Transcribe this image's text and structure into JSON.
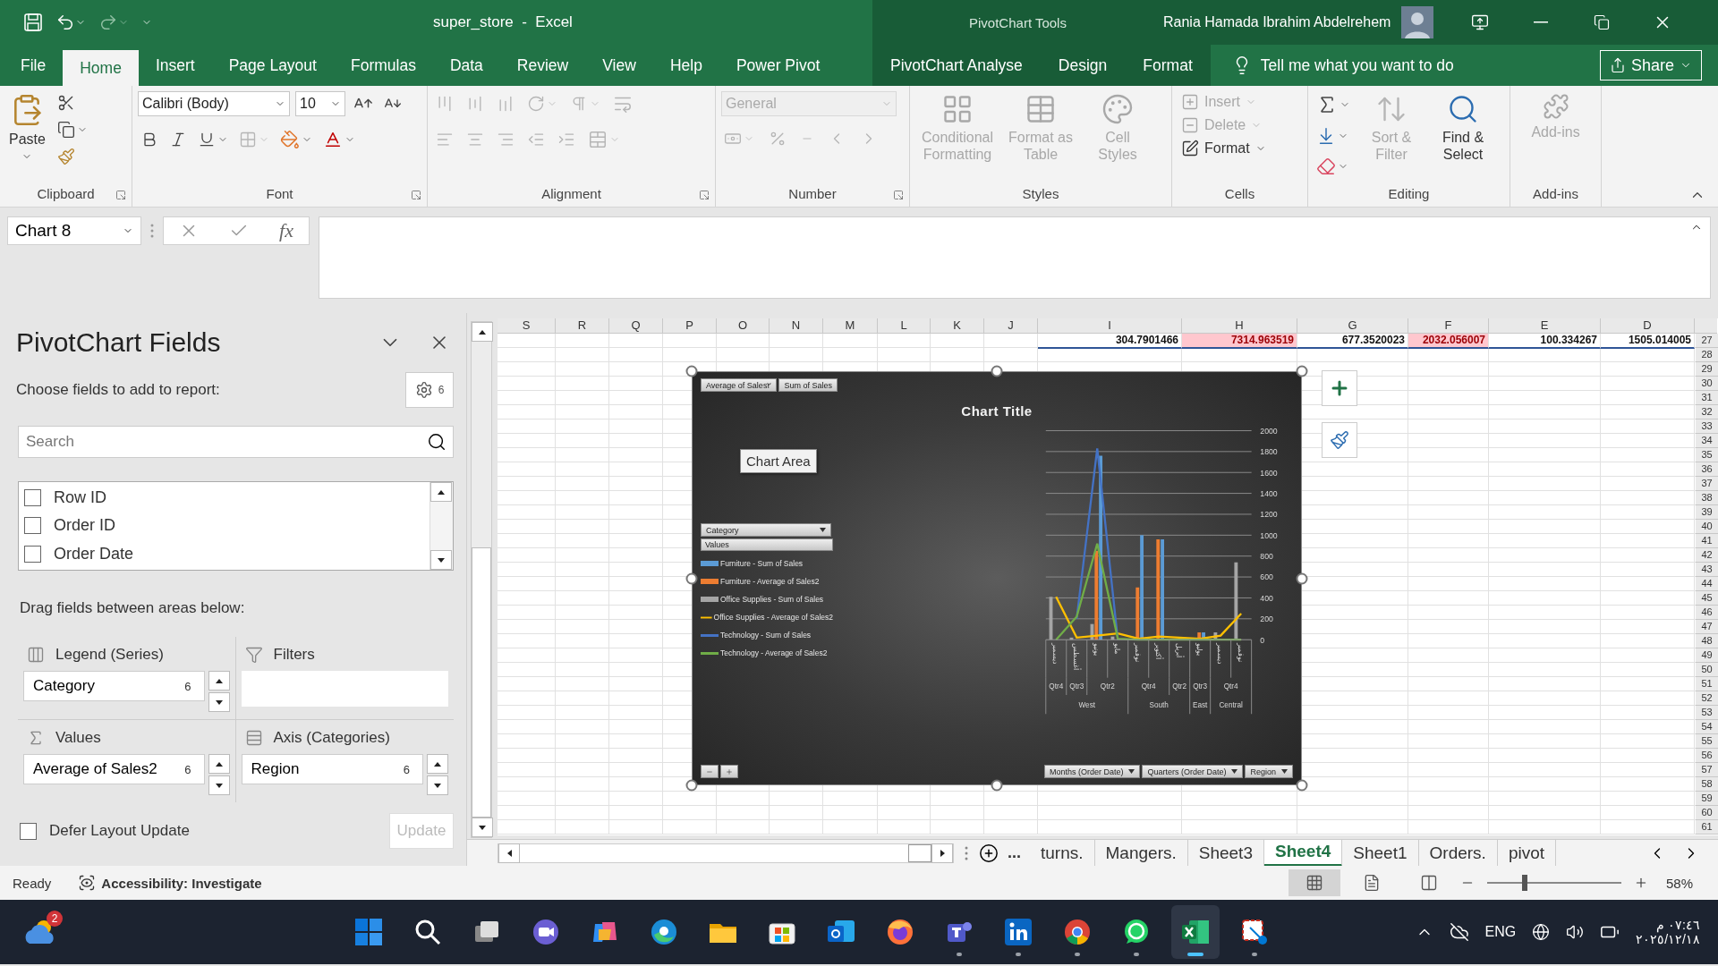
{
  "title_bar": {
    "document_title": "super_store  -  Excel",
    "contextual_tools": "PivotChart Tools",
    "user_name": "Rania Hamada Ibrahim Abdelrehem"
  },
  "ribbon_tabs": [
    {
      "label": "File",
      "selected": false,
      "contextual": false
    },
    {
      "label": "Home",
      "selected": true,
      "contextual": false
    },
    {
      "label": "Insert",
      "selected": false,
      "contextual": false
    },
    {
      "label": "Page Layout",
      "selected": false,
      "contextual": false
    },
    {
      "label": "Formulas",
      "selected": false,
      "contextual": false
    },
    {
      "label": "Data",
      "selected": false,
      "contextual": false
    },
    {
      "label": "Review",
      "selected": false,
      "contextual": false
    },
    {
      "label": "View",
      "selected": false,
      "contextual": false
    },
    {
      "label": "Help",
      "selected": false,
      "contextual": false
    },
    {
      "label": "Power Pivot",
      "selected": false,
      "contextual": false
    },
    {
      "label": "PivotChart Analyse",
      "selected": false,
      "contextual": true
    },
    {
      "label": "Design",
      "selected": false,
      "contextual": true
    },
    {
      "label": "Format",
      "selected": false,
      "contextual": true
    }
  ],
  "tell_me": "Tell me what you want to do",
  "share_button": "Share",
  "ribbon_groups": [
    {
      "kind": "clipboard",
      "label": "Clipboard",
      "paste": "Paste"
    },
    {
      "kind": "font",
      "label": "Font",
      "font_name": "Calibri (Body)",
      "font_size": "10"
    },
    {
      "kind": "alignment",
      "label": "Alignment",
      "disabled": true
    },
    {
      "kind": "number",
      "label": "Number",
      "format": "General",
      "disabled": true
    },
    {
      "kind": "styles",
      "label": "Styles",
      "buttons": [
        {
          "label": "Conditional Formatting",
          "disabled": true
        },
        {
          "label": "Format as Table",
          "disabled": true
        },
        {
          "label": "Cell Styles",
          "disabled": true
        }
      ]
    },
    {
      "kind": "cells",
      "label": "Cells",
      "buttons": [
        {
          "label": "Insert",
          "disabled": true
        },
        {
          "label": "Delete",
          "disabled": true
        },
        {
          "label": "Format",
          "disabled": false
        }
      ]
    },
    {
      "kind": "editing",
      "label": "Editing",
      "buttons": [
        {
          "label": "Sort & Filter",
          "disabled": true
        },
        {
          "label": "Find & Select",
          "disabled": false
        }
      ]
    },
    {
      "kind": "addins",
      "label": "Add-ins",
      "buttons": [
        {
          "label": "Add-ins",
          "disabled": true
        }
      ]
    }
  ],
  "formula_bar": {
    "name_box": "Chart 8",
    "function_label": "fx"
  },
  "pivot_pane": {
    "title": "PivotChart Fields",
    "instruction": "Choose fields to add to report:",
    "tools_badge": "6",
    "search": {
      "placeholder": "Search"
    },
    "fields": [
      {
        "label": "Row ID",
        "checked": false
      },
      {
        "label": "Order ID",
        "checked": false
      },
      {
        "label": "Order Date",
        "checked": false
      }
    ],
    "areas_instruction": "Drag fields between areas below:",
    "areas": [
      {
        "kind": "legend",
        "label": "Legend (Series)",
        "items": [
          {
            "label": "Category",
            "count": "6"
          }
        ]
      },
      {
        "kind": "filters",
        "label": "Filters"
      },
      {
        "kind": "values",
        "label": "Values",
        "items": [
          {
            "label": "Average of Sales2",
            "count": "6"
          }
        ]
      },
      {
        "kind": "axis",
        "label": "Axis (Categories)",
        "items": [
          {
            "label": "Region",
            "count": "6"
          }
        ]
      }
    ],
    "defer_update": {
      "label": "Defer Layout Update",
      "checked": false
    },
    "update_button": {
      "label": "Update",
      "disabled": true
    }
  },
  "sheet": {
    "columns": [
      "S",
      "R",
      "Q",
      "P",
      "O",
      "N",
      "M",
      "L",
      "K",
      "J",
      "I",
      "H",
      "G",
      "F",
      "E",
      "D"
    ],
    "row_numbers": [
      "27",
      "28",
      "29",
      "30",
      "31",
      "32",
      "33",
      "34",
      "35",
      "36",
      "37",
      "38",
      "39",
      "40",
      "41",
      "42",
      "43",
      "44",
      "45",
      "46",
      "47",
      "48",
      "49",
      "50",
      "51",
      "52",
      "53",
      "54",
      "55",
      "56",
      "57",
      "58",
      "59",
      "60",
      "61"
    ],
    "first_row_cells": [
      {
        "value": "304.7901466",
        "highlighted": false
      },
      {
        "value": "7314.963519",
        "highlighted": true
      },
      {
        "value": "677.3520023",
        "highlighted": false
      },
      {
        "value": "2032.056007",
        "highlighted": true
      },
      {
        "value": "100.334267",
        "highlighted": false
      },
      {
        "value": "1505.014005",
        "highlighted": false
      }
    ]
  },
  "chart": {
    "field_buttons_top": [
      "Average of Sales٢",
      "Sum of Sales"
    ],
    "tooltip": "Chart Area",
    "legend_field": "Category",
    "legend_header": "Values",
    "axis_field_buttons": [
      "Months (Order Date)",
      "Quarters (Order Date)",
      "Region"
    ],
    "chart_data": {
      "type": "bar",
      "title": "Chart Title",
      "categories": [
        "ديسمبر",
        "أغسطس",
        "يونيو",
        "مايو",
        "نوفمبر",
        "أكتوبر",
        "أبريل",
        "يوليو",
        "ديسمبر",
        "نوفمبر"
      ],
      "stacked": false,
      "grid": true,
      "series": [
        {
          "name": "Furniture - Sum of Sales",
          "type": "bar",
          "color": "#5b9bd5",
          "values": [
            null,
            null,
            1760,
            null,
            1000,
            960,
            null,
            70,
            null,
            null
          ]
        },
        {
          "name": "Furniture - Average of Sales2",
          "type": "bar",
          "color": "#ed7d31",
          "values": [
            null,
            null,
            850,
            null,
            500,
            960,
            null,
            70,
            null,
            null
          ]
        },
        {
          "name": "Office Supplies - Sum of Sales",
          "type": "bar",
          "color": "#a5a5a5",
          "values": [
            410,
            20,
            150,
            30,
            null,
            null,
            null,
            null,
            70,
            740
          ]
        },
        {
          "name": "Office Supplies - Average of Sales2",
          "type": "line",
          "color": "#ffc000",
          "values": [
            410,
            20,
            40,
            60,
            10,
            30,
            20,
            10,
            40,
            250
          ]
        },
        {
          "name": "Technology - Sum of Sales",
          "type": "line",
          "color": "#4472c4",
          "values": [
            null,
            200,
            1830,
            0,
            null,
            null,
            null,
            null,
            null,
            null
          ]
        },
        {
          "name": "Technology - Average of Sales2",
          "type": "line",
          "color": "#70ad47",
          "values": [
            0,
            220,
            920,
            10,
            0,
            0,
            0,
            0,
            0,
            0
          ]
        }
      ],
      "ylim": [
        0,
        2000
      ],
      "yticks": [
        0,
        200,
        400,
        600,
        800,
        1000,
        1200,
        1400,
        1600,
        1800,
        2000
      ]
    },
    "axis_groups": [
      {
        "kind": "quarter",
        "labels": [
          "Qtr4",
          "Qtr3",
          "Qtr2",
          "Qtr4",
          "Qtr2",
          "Qtr3",
          "Qtr4"
        ],
        "starts": [
          true,
          true,
          true,
          false,
          true,
          false,
          true,
          true,
          true,
          false
        ]
      },
      {
        "kind": "region",
        "labels": [
          "West",
          "South",
          "East",
          "Central"
        ],
        "starts": [
          true,
          false,
          false,
          false,
          true,
          false,
          false,
          true,
          true,
          false
        ]
      }
    ]
  },
  "sheet_tabs": {
    "overflow_label": "...",
    "tabs": [
      {
        "label": "turns.",
        "selected": false
      },
      {
        "label": "Mangers.",
        "selected": false
      },
      {
        "label": "Sheet3",
        "selected": false
      },
      {
        "label": "Sheet4",
        "selected": true
      },
      {
        "label": "Sheet1",
        "selected": false
      },
      {
        "label": "Orders.",
        "selected": false
      },
      {
        "label": "pivot",
        "selected": false
      }
    ]
  },
  "status_bar": {
    "status": "Ready",
    "accessibility": "Accessibility: Investigate",
    "views": [
      {
        "kind": "normal",
        "selected": true
      },
      {
        "kind": "page_layout",
        "selected": false
      },
      {
        "kind": "page_break",
        "selected": false
      }
    ],
    "zoom": {
      "level": 0.28,
      "reading": "58%"
    }
  },
  "taskbar": {
    "weather_badge": "2",
    "apps": [
      {
        "kind": "windows",
        "running": false,
        "active": false
      },
      {
        "kind": "search",
        "running": false,
        "active": false
      },
      {
        "kind": "task_view",
        "running": false,
        "active": false
      },
      {
        "kind": "video_chat",
        "running": false,
        "active": false
      },
      {
        "kind": "copilot",
        "running": false,
        "active": false
      },
      {
        "kind": "edge",
        "running": false,
        "active": false
      },
      {
        "kind": "folder",
        "running": false,
        "active": false
      },
      {
        "kind": "store",
        "running": false,
        "active": false
      },
      {
        "kind": "mail",
        "running": false,
        "active": false
      },
      {
        "kind": "firefox",
        "running": false,
        "active": false
      },
      {
        "kind": "teams",
        "running": true,
        "active": false
      },
      {
        "kind": "linkedin",
        "running": true,
        "active": false
      },
      {
        "kind": "chrome",
        "running": true,
        "active": false
      },
      {
        "kind": "whatsapp",
        "running": true,
        "active": false
      },
      {
        "kind": "excel",
        "running": true,
        "active": true
      },
      {
        "kind": "snipping",
        "running": true,
        "active": false
      }
    ],
    "language": "ENG",
    "time": "٠٧:٤٦ م",
    "date": "٢٠٢٥/١٢/١٨"
  }
}
